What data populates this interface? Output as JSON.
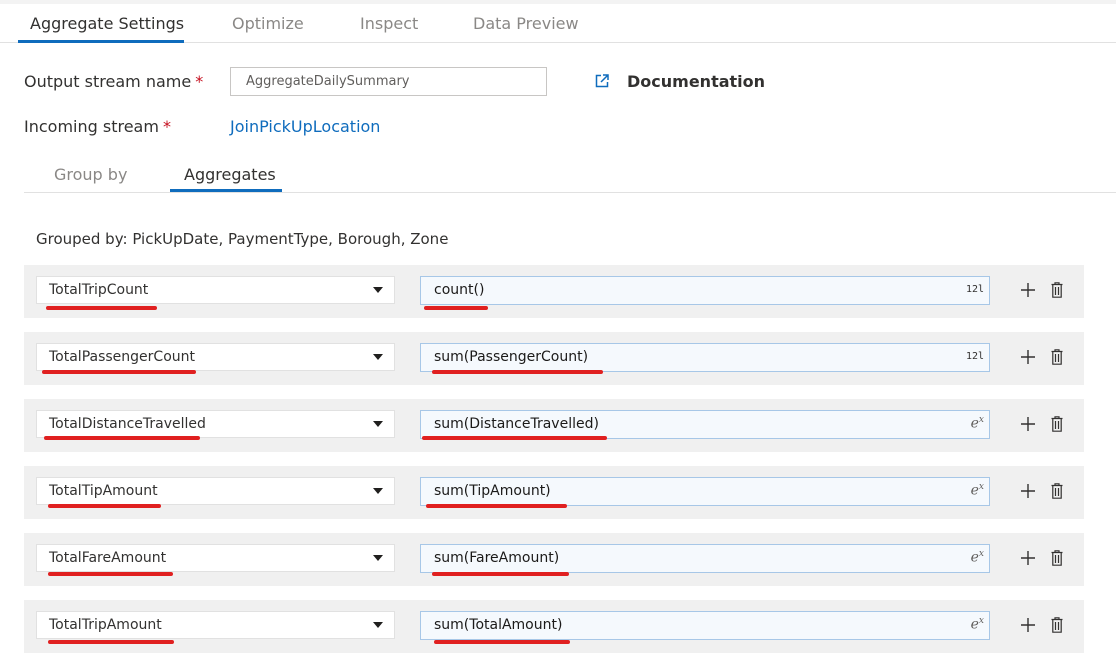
{
  "tabs": [
    {
      "label": "Aggregate Settings"
    },
    {
      "label": "Optimize"
    },
    {
      "label": "Inspect"
    },
    {
      "label": "Data Preview"
    }
  ],
  "form": {
    "output_stream_label": "Output stream name",
    "output_stream_value": "AggregateDailySummary",
    "incoming_stream_label": "Incoming stream",
    "incoming_stream_value": "JoinPickUpLocation",
    "required_marker": "*",
    "documentation_label": "Documentation"
  },
  "subtabs": [
    {
      "label": "Group by"
    },
    {
      "label": "Aggregates"
    }
  ],
  "grouped_by": "Grouped by: PickUpDate, PaymentType, Borough, Zone",
  "aggregates": [
    {
      "column": "TotalTripCount",
      "expression": "count()",
      "type_badge": "12l"
    },
    {
      "column": "TotalPassengerCount",
      "expression": "sum(PassengerCount)",
      "type_badge": "12l"
    },
    {
      "column": "TotalDistanceTravelled",
      "expression": "sum(DistanceTravelled)",
      "type_badge": "ex"
    },
    {
      "column": "TotalTipAmount",
      "expression": "sum(TipAmount)",
      "type_badge": "ex"
    },
    {
      "column": "TotalFareAmount",
      "expression": "sum(FareAmount)",
      "type_badge": "ex"
    },
    {
      "column": "TotalTripAmount",
      "expression": "sum(TotalAmount)",
      "type_badge": "ex"
    }
  ],
  "icons": {
    "documentation": "open-external-icon",
    "dropdown": "chevron-down-icon",
    "add": "plus-icon",
    "delete": "trash-icon",
    "integer_type": "integer-type-icon",
    "expression_type": "expression-type-icon"
  },
  "colors": {
    "accent": "#0f6cbd",
    "required": "#c50f1f",
    "annotation": "#e02020"
  }
}
